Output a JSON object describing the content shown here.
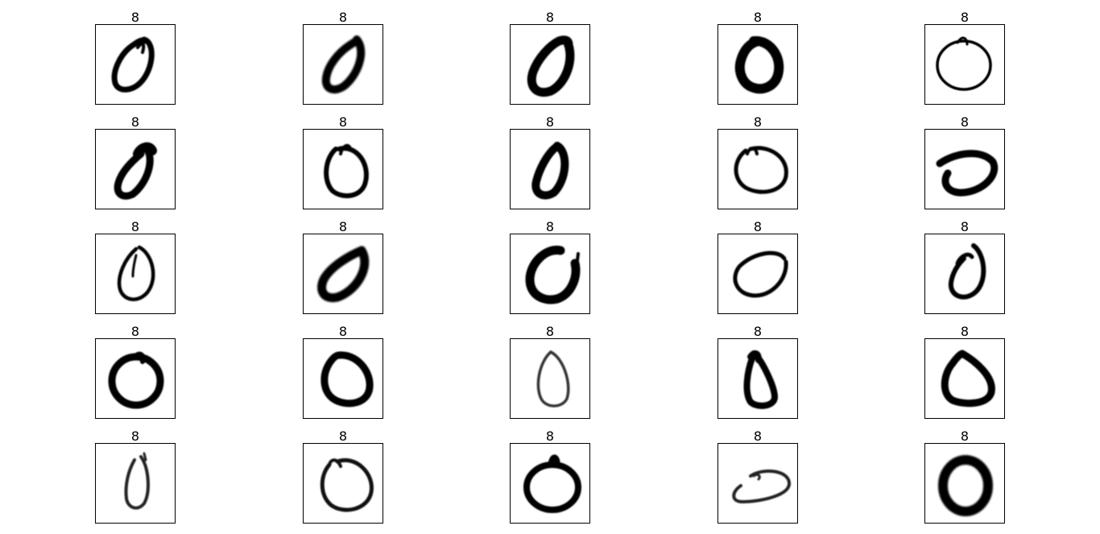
{
  "grid": {
    "rows": 5,
    "cols": 5,
    "cells": [
      {
        "title": "8"
      },
      {
        "title": "8"
      },
      {
        "title": "8"
      },
      {
        "title": "8"
      },
      {
        "title": "8"
      },
      {
        "title": "8"
      },
      {
        "title": "8"
      },
      {
        "title": "8"
      },
      {
        "title": "8"
      },
      {
        "title": "8"
      },
      {
        "title": "8"
      },
      {
        "title": "8"
      },
      {
        "title": "8"
      },
      {
        "title": "8"
      },
      {
        "title": "8"
      },
      {
        "title": "8"
      },
      {
        "title": "8"
      },
      {
        "title": "8"
      },
      {
        "title": "8"
      },
      {
        "title": "8"
      },
      {
        "title": "8"
      },
      {
        "title": "8"
      },
      {
        "title": "8"
      },
      {
        "title": "8"
      },
      {
        "title": "8"
      }
    ]
  },
  "colors": {
    "ink": "#000000",
    "frame": "#000000",
    "background": "#ffffff"
  }
}
